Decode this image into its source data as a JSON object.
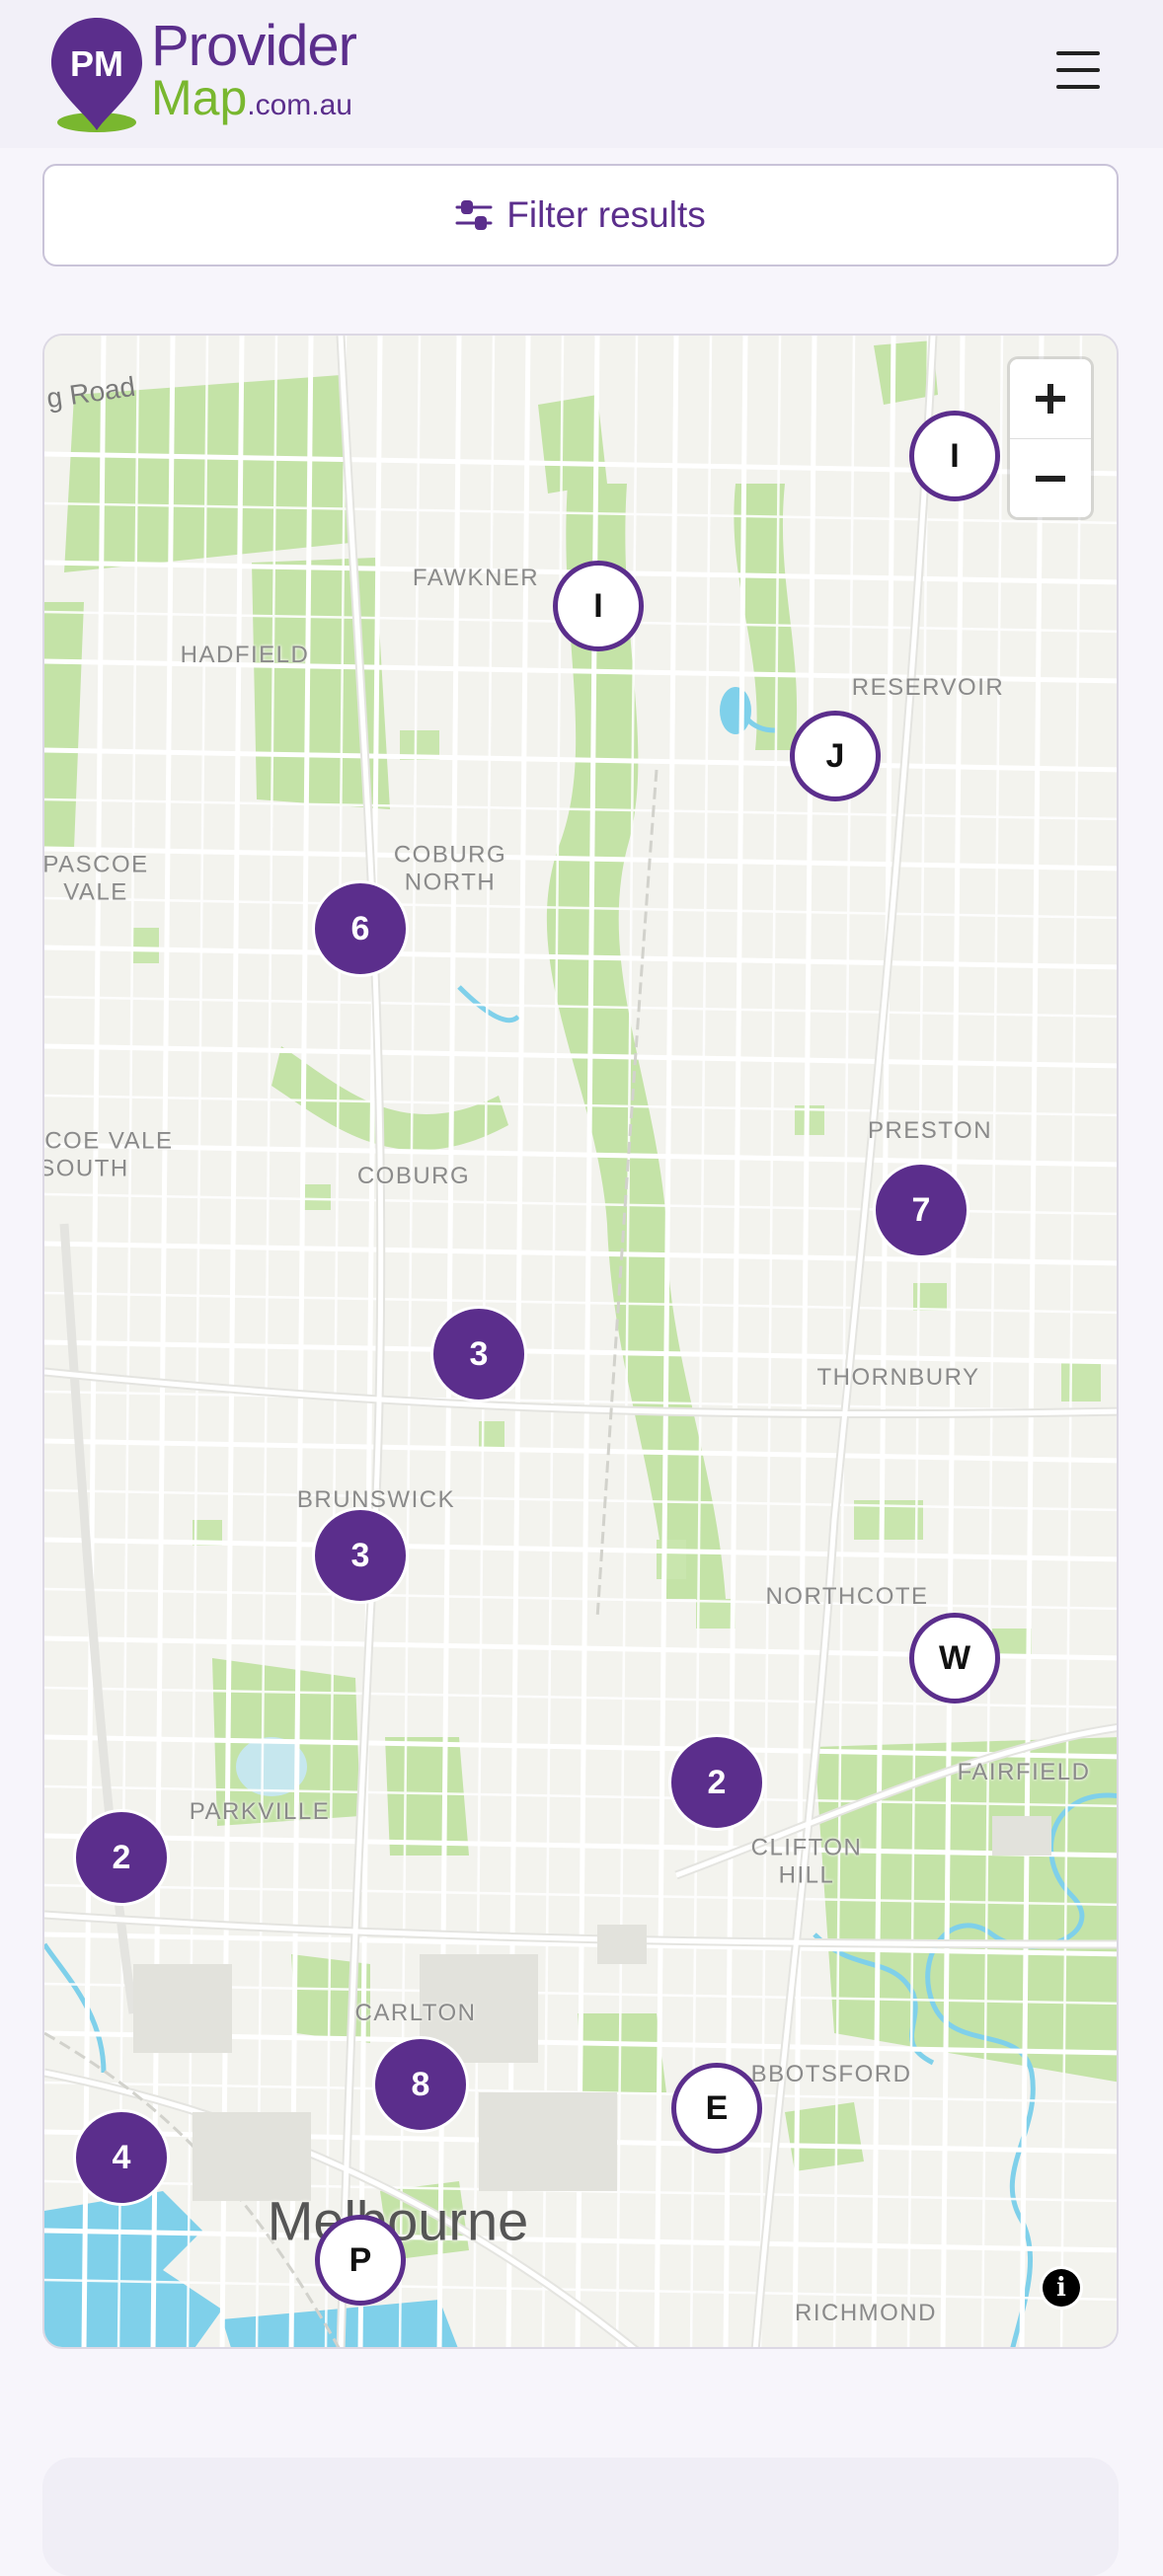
{
  "header": {
    "logo_initials": "PM",
    "logo_provider": "Provider",
    "logo_map": "Map",
    "logo_domain": ".com.au",
    "menu_icon": "hamburger-menu-icon"
  },
  "filter": {
    "label": "Filter results",
    "icon": "sliders-icon"
  },
  "map": {
    "zoom_in": "+",
    "zoom_out": "−",
    "info": "i",
    "road_label": "g Road",
    "city_label": "Melbourne",
    "suburbs": [
      {
        "name": "Fawkner"
      },
      {
        "name": "Hadfield"
      },
      {
        "name": "Reservoir"
      },
      {
        "name": "Coburg North"
      },
      {
        "name": "Pascoe Vale"
      },
      {
        "name": "Preston"
      },
      {
        "name": "Pascoe Vale South"
      },
      {
        "name": "Coburg"
      },
      {
        "name": "Thornbury"
      },
      {
        "name": "Brunswick"
      },
      {
        "name": "Northcote"
      },
      {
        "name": "Fairfield"
      },
      {
        "name": "Parkville"
      },
      {
        "name": "Clifton Hill"
      },
      {
        "name": "Carlton"
      },
      {
        "name": "bbotsford"
      },
      {
        "name": "Richmond"
      }
    ],
    "markers": [
      {
        "label": "I",
        "kind": "pin"
      },
      {
        "label": "I",
        "kind": "pin"
      },
      {
        "label": "J",
        "kind": "pin"
      },
      {
        "label": "6",
        "kind": "cluster"
      },
      {
        "label": "7",
        "kind": "cluster"
      },
      {
        "label": "3",
        "kind": "cluster"
      },
      {
        "label": "3",
        "kind": "cluster"
      },
      {
        "label": "W",
        "kind": "pin"
      },
      {
        "label": "2",
        "kind": "cluster"
      },
      {
        "label": "2",
        "kind": "cluster"
      },
      {
        "label": "8",
        "kind": "cluster"
      },
      {
        "label": "E",
        "kind": "pin"
      },
      {
        "label": "4",
        "kind": "cluster"
      },
      {
        "label": "P",
        "kind": "pin"
      }
    ]
  },
  "colors": {
    "brand_purple": "#5b2e8c",
    "brand_green": "#79b72f",
    "park_green": "#c4e3a7",
    "water_blue": "#7fd0ea"
  }
}
